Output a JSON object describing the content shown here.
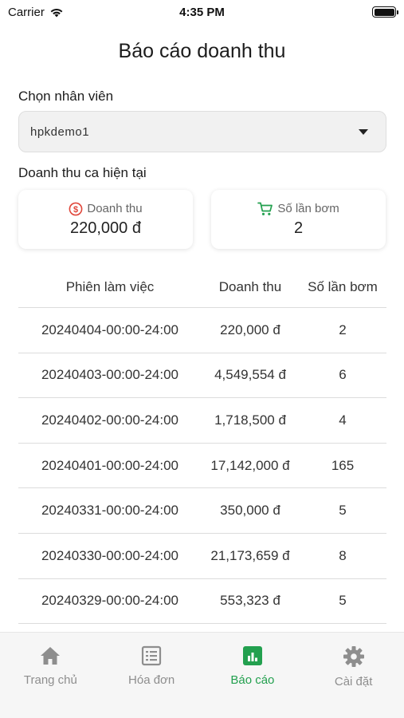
{
  "status": {
    "carrier": "Carrier",
    "time": "4:35 PM"
  },
  "title": "Báo cáo doanh thu",
  "employee": {
    "label": "Chọn nhân viên",
    "selected": "hpkdemo1"
  },
  "current_shift": {
    "label": "Doanh thu ca hiện tại",
    "revenue_label": "Doanh thu",
    "revenue_value": "220,000 đ",
    "pumps_label": "Số lần bơm",
    "pumps_value": "2"
  },
  "table": {
    "headers": [
      "Phiên làm việc",
      "Doanh thu",
      "Số lần bơm"
    ],
    "rows": [
      [
        "20240404-00:00-24:00",
        "220,000 đ",
        "2"
      ],
      [
        "20240403-00:00-24:00",
        "4,549,554 đ",
        "6"
      ],
      [
        "20240402-00:00-24:00",
        "1,718,500 đ",
        "4"
      ],
      [
        "20240401-00:00-24:00",
        "17,142,000 đ",
        "165"
      ],
      [
        "20240331-00:00-24:00",
        "350,000 đ",
        "5"
      ],
      [
        "20240330-00:00-24:00",
        "21,173,659 đ",
        "8"
      ],
      [
        "20240329-00:00-24:00",
        "553,323 đ",
        "5"
      ]
    ]
  },
  "tabs": [
    {
      "label": "Trang chủ",
      "icon": "home-icon",
      "active": false
    },
    {
      "label": "Hóa đơn",
      "icon": "invoice-icon",
      "active": false
    },
    {
      "label": "Báo cáo",
      "icon": "report-icon",
      "active": true
    },
    {
      "label": "Cài đặt",
      "icon": "gear-icon",
      "active": false
    }
  ],
  "colors": {
    "accent": "#23a04f",
    "revenue_icon": "#e0463a",
    "inactive": "#8e8e8e"
  }
}
